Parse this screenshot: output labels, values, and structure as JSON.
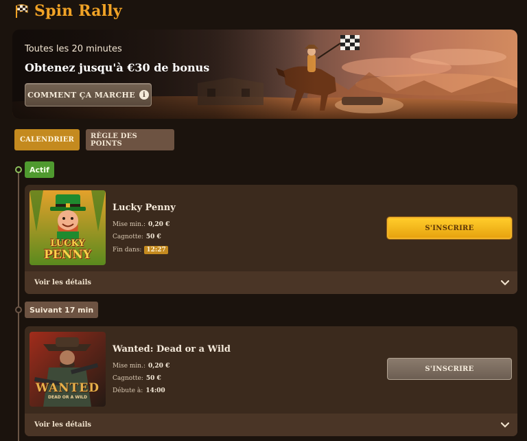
{
  "header": {
    "title": "Spin Rally",
    "icon": "checkered-flag-icon"
  },
  "banner": {
    "subtitle": "Toutes les 20 minutes",
    "title": "Obtenez jusqu'à €30 de bonus",
    "how_button_label": "COMMENT ÇA MARCHE",
    "how_button_icon": "info-icon"
  },
  "tabs": [
    {
      "label": "CALENDRIER",
      "active": true
    },
    {
      "label": "RÈGLE DES POINTS",
      "active": false
    }
  ],
  "events": [
    {
      "status": "Actif",
      "game": "Lucky Penny",
      "thumb_text_1": "LUCKY",
      "thumb_text_2": "PENNY",
      "min_bet_label": "Mise min.:",
      "min_bet_value": "0,20 €",
      "pot_label": "Cagnotte:",
      "pot_value": "50 €",
      "time_label": "Fin dans:",
      "time_value": "12:27",
      "button_label": "S'INSCRIRE",
      "details_label": "Voir les détails"
    },
    {
      "status": "Suivant 17 min",
      "game": "Wanted: Dead or a Wild",
      "thumb_text_1": "WANTED",
      "thumb_text_2": "DEAD OR A WILD",
      "min_bet_label": "Mise min.:",
      "min_bet_value": "0,20 €",
      "pot_label": "Cagnotte:",
      "pot_value": "50 €",
      "time_label": "Débute à:",
      "time_value": "14:00",
      "button_label": "S'INSCRIRE",
      "details_label": "Voir les détails"
    }
  ],
  "colors": {
    "background": "#1b130d",
    "brand": "#f1a326",
    "tab_active": "#c48a1f",
    "status_active": "#4f9a2f",
    "card": "#3b2a1d",
    "cta": "#ffcc2a"
  }
}
